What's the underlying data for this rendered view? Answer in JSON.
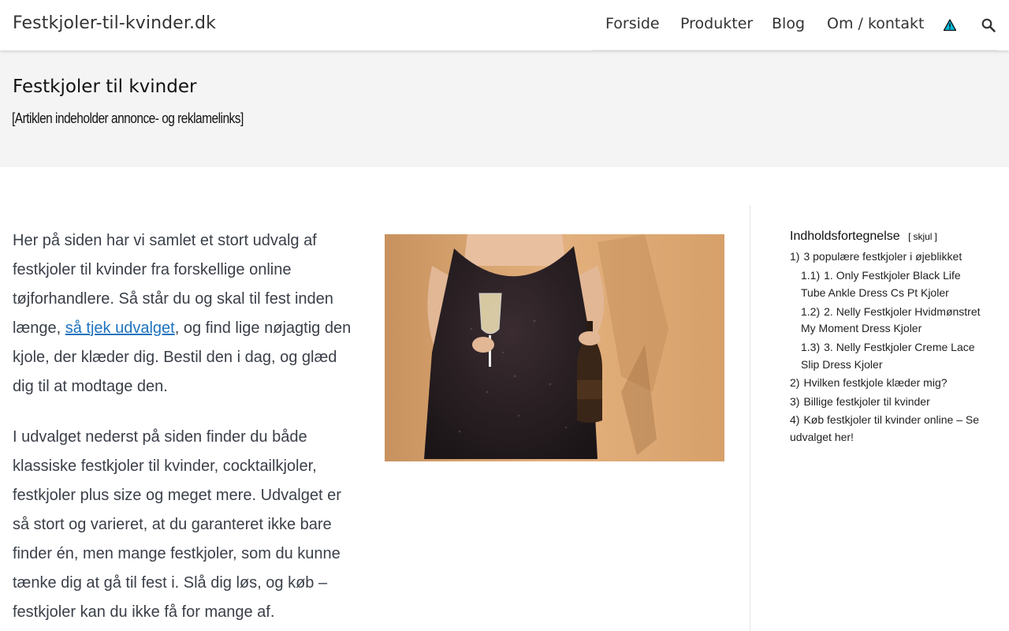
{
  "site": {
    "title": "Festkjoler-til-kvinder.dk"
  },
  "nav": {
    "items": [
      {
        "label": "Forside"
      },
      {
        "label": "Produkter"
      },
      {
        "label": "Blog"
      },
      {
        "label": "Om / kontakt"
      }
    ],
    "icons": {
      "warning": "warning-triangle-icon",
      "search": "search-icon"
    },
    "warning_color": "#00b8d9"
  },
  "hero": {
    "title": "Festkjoler til kvinder",
    "disclaimer": "[Artiklen indeholder annonce- og reklamelinks]",
    "background": "#f4f4f4"
  },
  "content": {
    "p1_before": "Her på siden har vi samlet et stort udvalg af festkjoler til kvinder fra forskellige online tøjforhandlere. Så står du og skal til fest inden længe, ",
    "p1_link": "så tjek udvalget",
    "p1_after": ", og find lige nøjagtig den kjole, der klæder dig. Bestil den i dag, og glæd dig til at modtage den.",
    "p2": "I udvalget nederst på siden finder du både klassiske festkjoler til kvinder, cocktailkjoler, festkjoler plus size og meget mere. Udvalget er så stort og varieret, at du garanteret ikke bare finder én, men mange festkjoler, som du kunne tænke dig at gå til fest i. Slå dig løs, og køb – festkjoler kan du ikke få for mange af.",
    "link_color": "#1e73be"
  },
  "toc": {
    "title": "Indholdsfortegnelse",
    "toggle_open": "[",
    "toggle_label": "skjul",
    "toggle_close": "]",
    "items": [
      {
        "num": "1)",
        "label": "3 populære festkjoler i øjeblikket",
        "level": 1
      },
      {
        "num": "1.1)",
        "label": "1. Only Festkjoler Black Life Tube Ankle Dress Cs Pt Kjoler",
        "level": 2
      },
      {
        "num": "1.2)",
        "label": "2. Nelly Festkjoler Hvidmønstret My Moment Dress Kjoler",
        "level": 2
      },
      {
        "num": "1.3)",
        "label": "3. Nelly Festkjoler Creme Lace Slip Dress Kjoler",
        "level": 2
      },
      {
        "num": "2)",
        "label": "Hvilken festkjole klæder mig?",
        "level": 1
      },
      {
        "num": "3)",
        "label": "Billige festkjoler til kvinder",
        "level": 1
      },
      {
        "num": "4)",
        "label": "Køb festkjoler til kvinder online – Se udvalget her!",
        "level": 1
      }
    ]
  }
}
